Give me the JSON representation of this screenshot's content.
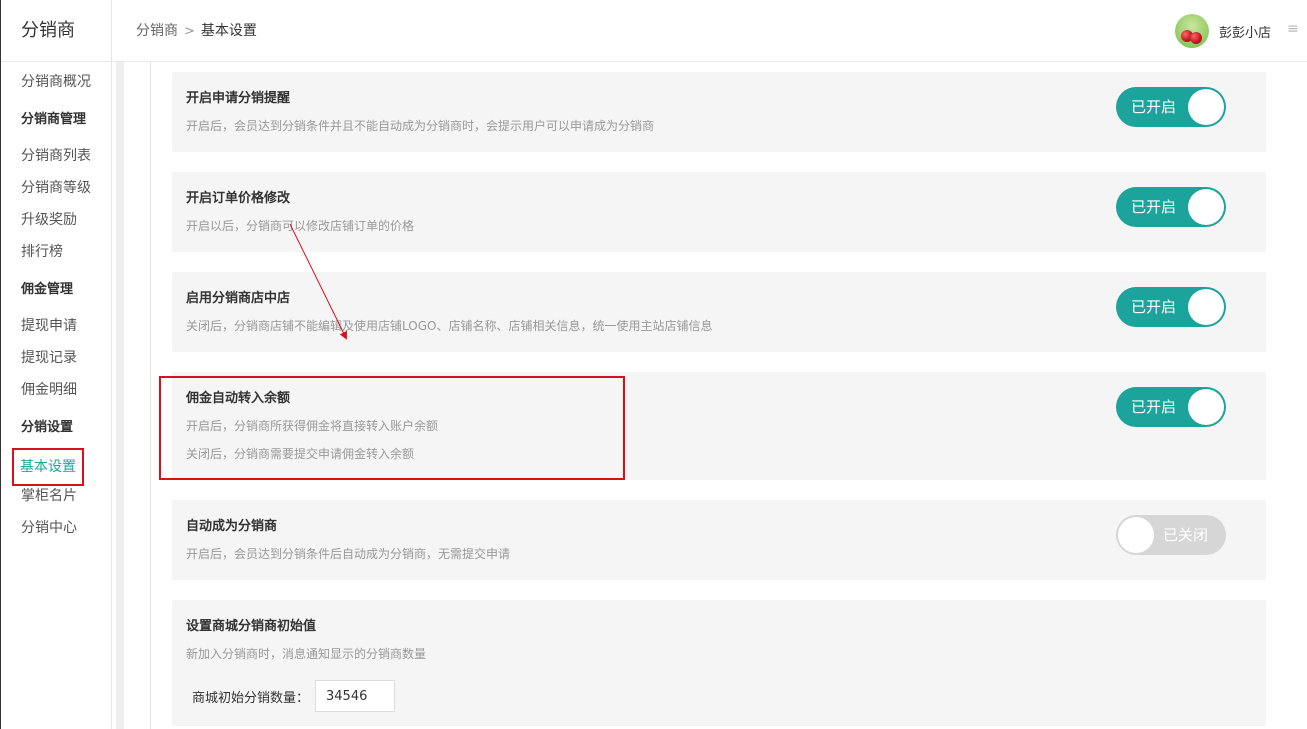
{
  "brand": "分销商",
  "breadcrumb": {
    "parent": "分销商",
    "separator": ">",
    "current": "基本设置"
  },
  "user": {
    "name": "彭彭小店",
    "avatar_icon": "cherry-avatar-icon",
    "menu_icon": "≡"
  },
  "sidebar": {
    "items": [
      {
        "type": "item",
        "label": "分销商概况"
      },
      {
        "type": "group",
        "label": "分销商管理"
      },
      {
        "type": "item",
        "label": "分销商列表"
      },
      {
        "type": "item",
        "label": "分销商等级"
      },
      {
        "type": "item",
        "label": "升级奖励"
      },
      {
        "type": "item",
        "label": "排行榜"
      },
      {
        "type": "group",
        "label": "佣金管理"
      },
      {
        "type": "item",
        "label": "提现申请"
      },
      {
        "type": "item",
        "label": "提现记录"
      },
      {
        "type": "item",
        "label": "佣金明细"
      },
      {
        "type": "group",
        "label": "分销设置"
      },
      {
        "type": "item",
        "label": "基本设置",
        "active": true
      },
      {
        "type": "item",
        "label": "掌柜名片"
      },
      {
        "type": "item",
        "label": "分销中心"
      }
    ]
  },
  "settings": [
    {
      "title": "开启申请分销提醒",
      "descs": [
        "开启后，会员达到分销条件并且不能自动成为分销商时，会提示用户可以申请成为分销商"
      ],
      "state": "on",
      "toggle_label": "已开启"
    },
    {
      "title": "开启订单价格修改",
      "descs": [
        "开启以后，分销商可以修改店铺订单的价格"
      ],
      "state": "on",
      "toggle_label": "已开启"
    },
    {
      "title": "启用分销商店中店",
      "descs": [
        "关闭后，分销商店铺不能编辑及使用店铺LOGO、店铺名称、店铺相关信息，统一使用主站店铺信息"
      ],
      "state": "on",
      "toggle_label": "已开启"
    },
    {
      "title": "佣金自动转入余额",
      "descs": [
        "开启后，分销商所获得佣金将直接转入账户余额",
        "关闭后，分销商需要提交申请佣金转入余额"
      ],
      "state": "on",
      "toggle_label": "已开启"
    },
    {
      "title": "自动成为分销商",
      "descs": [
        "开启后，会员达到分销条件后自动成为分销商，无需提交申请"
      ],
      "state": "off",
      "toggle_label": "已关闭"
    }
  ],
  "initial_count": {
    "title": "设置商城分销商初始值",
    "desc": "新加入分销商时，消息通知显示的分销商数量",
    "field_label": "商城初始分销数量：",
    "field_value": "34546"
  },
  "colors": {
    "accent": "#1ba39c",
    "annotation": "#d9101a",
    "toggle_off": "#d6d6d6"
  }
}
